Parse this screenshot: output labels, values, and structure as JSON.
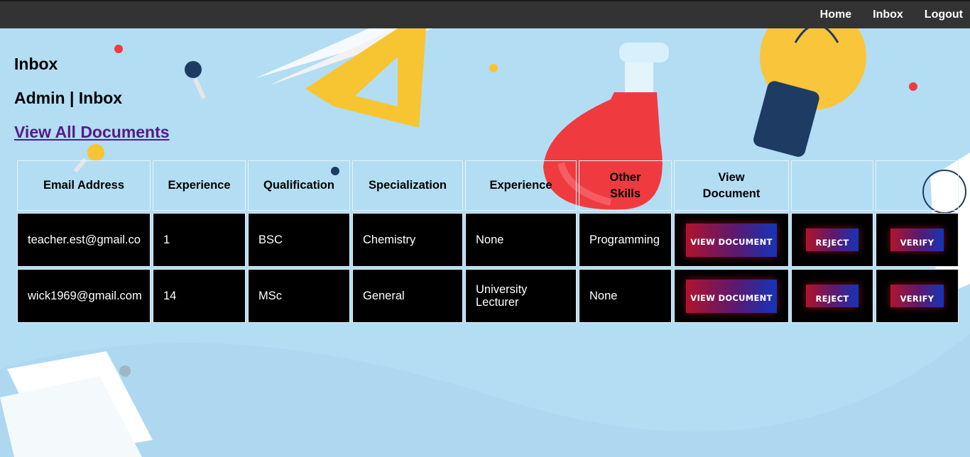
{
  "nav": {
    "links": [
      "Home",
      "Inbox",
      "Logout"
    ]
  },
  "page": {
    "title": "Inbox",
    "subtitle": "Admin | Inbox",
    "view_all_link": "View All Documents"
  },
  "table": {
    "headers": [
      "Email Address",
      "Experience",
      "Qualification",
      "Specialization",
      "Experience",
      "Other Skills",
      "View Document",
      "",
      ""
    ],
    "rows": [
      {
        "email": "teacher.est@gmail.co",
        "experience": "1",
        "qualification": "BSC",
        "specialization": "Chemistry",
        "experience2": "None",
        "other_skills": "Programming",
        "view_label": "VIEW DOCUMENT",
        "reject_label": "REJECT",
        "verify_label": "VERIFY"
      },
      {
        "email": "wick1969@gmail.com",
        "experience": "14",
        "qualification": "MSc",
        "specialization": "General",
        "experience2": "University Lecturer",
        "other_skills": "None",
        "view_label": "VIEW DOCUMENT",
        "reject_label": "REJECT",
        "verify_label": "VERIFY"
      }
    ]
  },
  "colors": {
    "topbar": "#333333",
    "background": "#b3ddf2",
    "link": "#551a8b",
    "cell": "#000000"
  }
}
